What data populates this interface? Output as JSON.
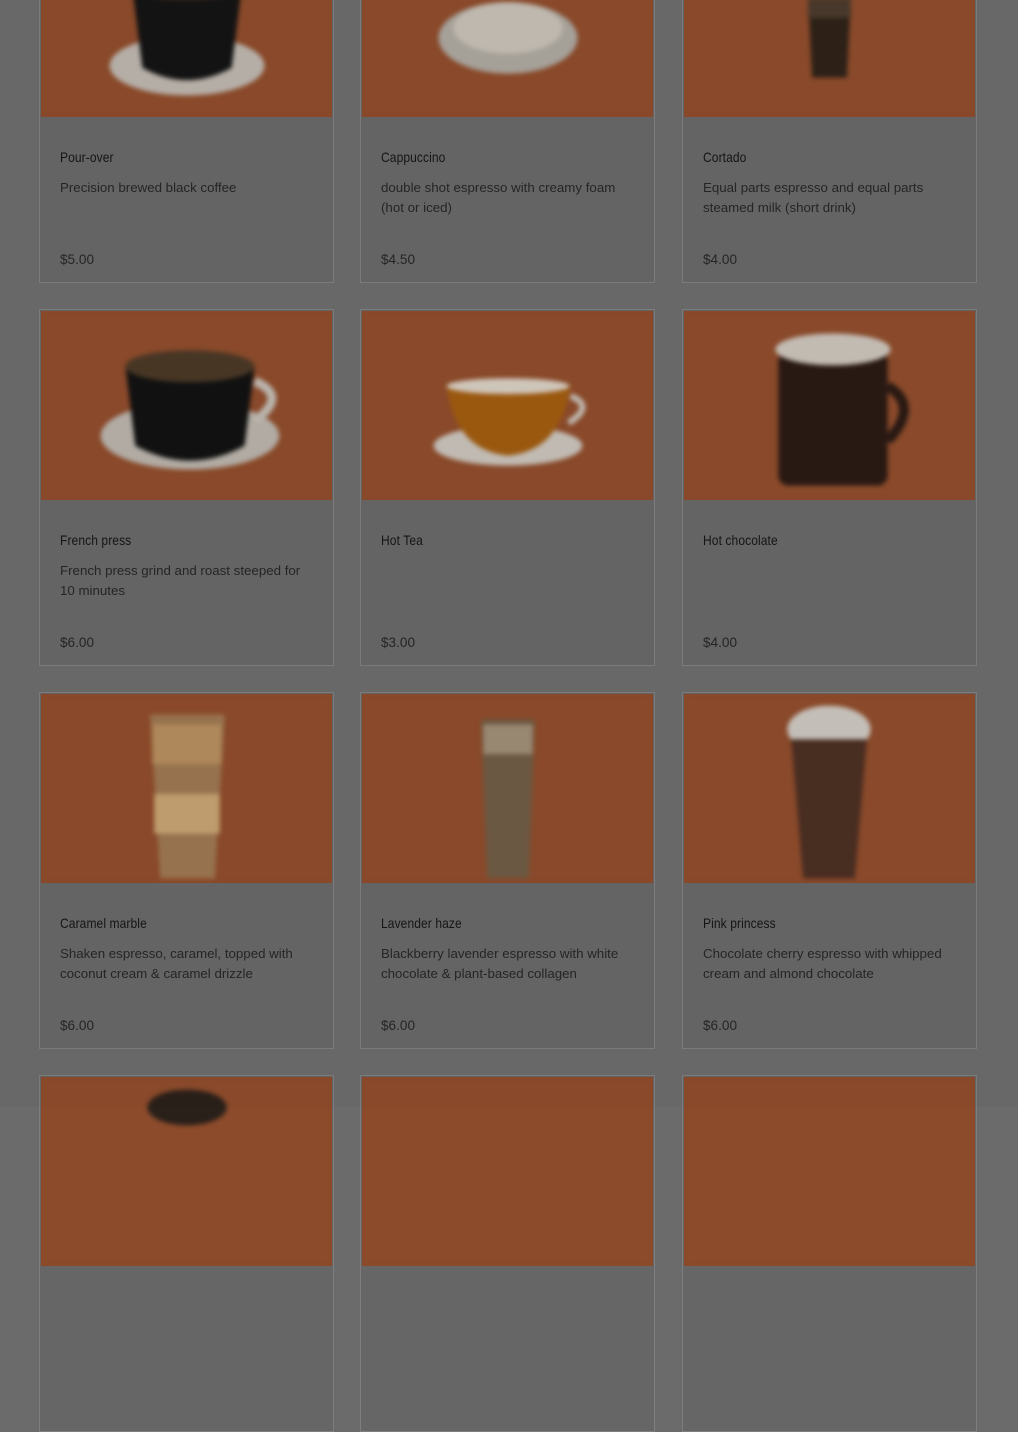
{
  "menu": {
    "items": [
      {
        "name": "Pour-over",
        "description": "Precision brewed black coffee",
        "price": "$5.00",
        "image_icon": "black-coffee-cup-icon"
      },
      {
        "name": "Cappuccino",
        "description": "double shot espresso with creamy foam (hot or iced)",
        "price": "$4.50",
        "image_icon": "cappuccino-cup-icon"
      },
      {
        "name": "Cortado",
        "description": "Equal parts espresso and equal parts steamed milk (short drink)",
        "price": "$4.00",
        "image_icon": "cortado-glass-icon"
      },
      {
        "name": "French press",
        "description": "French press grind and roast steeped for 10 minutes",
        "price": "$6.00",
        "image_icon": "black-coffee-cup-icon"
      },
      {
        "name": "Hot Tea",
        "description": "",
        "price": "$3.00",
        "image_icon": "tea-cup-icon"
      },
      {
        "name": "Hot chocolate",
        "description": "",
        "price": "$4.00",
        "image_icon": "hot-chocolate-mug-icon"
      },
      {
        "name": "Caramel marble",
        "description": "Shaken espresso, caramel, topped with coconut cream & caramel drizzle",
        "price": "$6.00",
        "image_icon": "iced-caramel-drink-icon"
      },
      {
        "name": "Lavender haze",
        "description": "Blackberry lavender espresso with white chocolate & plant-based collagen",
        "price": "$6.00",
        "image_icon": "iced-lavender-drink-icon"
      },
      {
        "name": "Pink princess",
        "description": "Chocolate cherry espresso with whipped cream and almond chocolate",
        "price": "$6.00",
        "image_icon": "iced-chocolate-drink-icon"
      }
    ]
  },
  "colors": {
    "image_background": "#8a4a2a",
    "overlay": "#6b6b6b"
  }
}
